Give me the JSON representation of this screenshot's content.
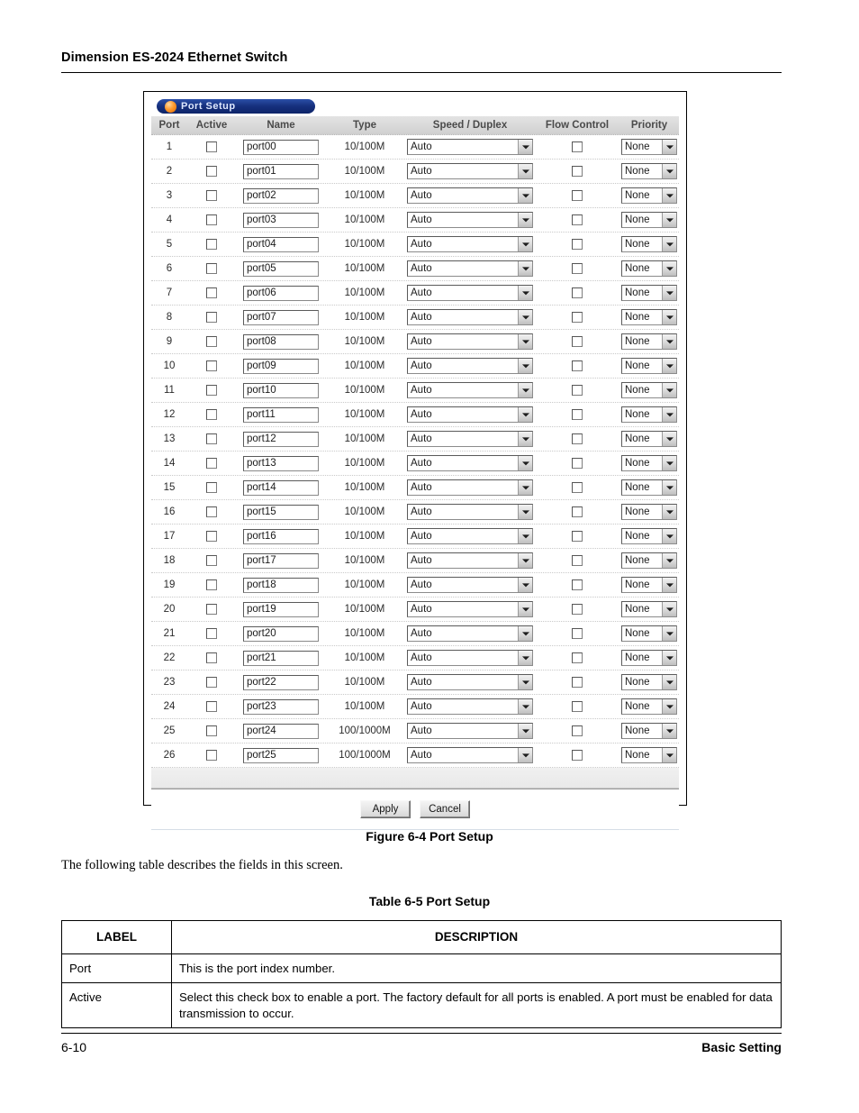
{
  "page": {
    "running_head": "Dimension ES-2024 Ethernet Switch",
    "footer_page_number": "6-10",
    "footer_section": "Basic Setting"
  },
  "figure": {
    "caption": "Figure 6-4 Port Setup",
    "intro_text": "The following table describes the fields in this screen.",
    "table_caption": "Table 6-5 Port Setup"
  },
  "screen": {
    "title": "Port Setup",
    "title_icon": "orange-orb-icon",
    "columns": [
      "Port",
      "Active",
      "Name",
      "Type",
      "Speed / Duplex",
      "Flow Control",
      "Priority"
    ],
    "buttons": {
      "apply": "Apply",
      "cancel": "Cancel"
    },
    "defaults": {
      "speed_duplex": "Auto",
      "priority": "None",
      "active_checked": false,
      "flow_control_checked": false
    },
    "colors": {
      "title_bar_start": "#2b4fa8",
      "title_bar_end": "#0d2468",
      "title_text": "#dfe9ff",
      "orb": "#ff9a2e",
      "header_bg": "#d9d9d9",
      "header_text": "#4a4a4a"
    },
    "rows": [
      {
        "port": "1",
        "name": "port00",
        "type": "10/100M",
        "speed_duplex": "Auto",
        "priority": "None"
      },
      {
        "port": "2",
        "name": "port01",
        "type": "10/100M",
        "speed_duplex": "Auto",
        "priority": "None"
      },
      {
        "port": "3",
        "name": "port02",
        "type": "10/100M",
        "speed_duplex": "Auto",
        "priority": "None"
      },
      {
        "port": "4",
        "name": "port03",
        "type": "10/100M",
        "speed_duplex": "Auto",
        "priority": "None"
      },
      {
        "port": "5",
        "name": "port04",
        "type": "10/100M",
        "speed_duplex": "Auto",
        "priority": "None"
      },
      {
        "port": "6",
        "name": "port05",
        "type": "10/100M",
        "speed_duplex": "Auto",
        "priority": "None"
      },
      {
        "port": "7",
        "name": "port06",
        "type": "10/100M",
        "speed_duplex": "Auto",
        "priority": "None"
      },
      {
        "port": "8",
        "name": "port07",
        "type": "10/100M",
        "speed_duplex": "Auto",
        "priority": "None"
      },
      {
        "port": "9",
        "name": "port08",
        "type": "10/100M",
        "speed_duplex": "Auto",
        "priority": "None"
      },
      {
        "port": "10",
        "name": "port09",
        "type": "10/100M",
        "speed_duplex": "Auto",
        "priority": "None"
      },
      {
        "port": "11",
        "name": "port10",
        "type": "10/100M",
        "speed_duplex": "Auto",
        "priority": "None"
      },
      {
        "port": "12",
        "name": "port11",
        "type": "10/100M",
        "speed_duplex": "Auto",
        "priority": "None"
      },
      {
        "port": "13",
        "name": "port12",
        "type": "10/100M",
        "speed_duplex": "Auto",
        "priority": "None"
      },
      {
        "port": "14",
        "name": "port13",
        "type": "10/100M",
        "speed_duplex": "Auto",
        "priority": "None"
      },
      {
        "port": "15",
        "name": "port14",
        "type": "10/100M",
        "speed_duplex": "Auto",
        "priority": "None"
      },
      {
        "port": "16",
        "name": "port15",
        "type": "10/100M",
        "speed_duplex": "Auto",
        "priority": "None"
      },
      {
        "port": "17",
        "name": "port16",
        "type": "10/100M",
        "speed_duplex": "Auto",
        "priority": "None"
      },
      {
        "port": "18",
        "name": "port17",
        "type": "10/100M",
        "speed_duplex": "Auto",
        "priority": "None"
      },
      {
        "port": "19",
        "name": "port18",
        "type": "10/100M",
        "speed_duplex": "Auto",
        "priority": "None"
      },
      {
        "port": "20",
        "name": "port19",
        "type": "10/100M",
        "speed_duplex": "Auto",
        "priority": "None"
      },
      {
        "port": "21",
        "name": "port20",
        "type": "10/100M",
        "speed_duplex": "Auto",
        "priority": "None"
      },
      {
        "port": "22",
        "name": "port21",
        "type": "10/100M",
        "speed_duplex": "Auto",
        "priority": "None"
      },
      {
        "port": "23",
        "name": "port22",
        "type": "10/100M",
        "speed_duplex": "Auto",
        "priority": "None"
      },
      {
        "port": "24",
        "name": "port23",
        "type": "10/100M",
        "speed_duplex": "Auto",
        "priority": "None"
      },
      {
        "port": "25",
        "name": "port24",
        "type": "100/1000M",
        "speed_duplex": "Auto",
        "priority": "None"
      },
      {
        "port": "26",
        "name": "port25",
        "type": "100/1000M",
        "speed_duplex": "Auto",
        "priority": "None"
      }
    ]
  },
  "description_table": {
    "headers": [
      "LABEL",
      "DESCRIPTION"
    ],
    "rows": [
      {
        "label": "Port",
        "description": "This is the port index number."
      },
      {
        "label": "Active",
        "description": "Select this check box to enable a port. The factory default for all ports is enabled. A port must be enabled for data transmission to occur."
      }
    ]
  }
}
